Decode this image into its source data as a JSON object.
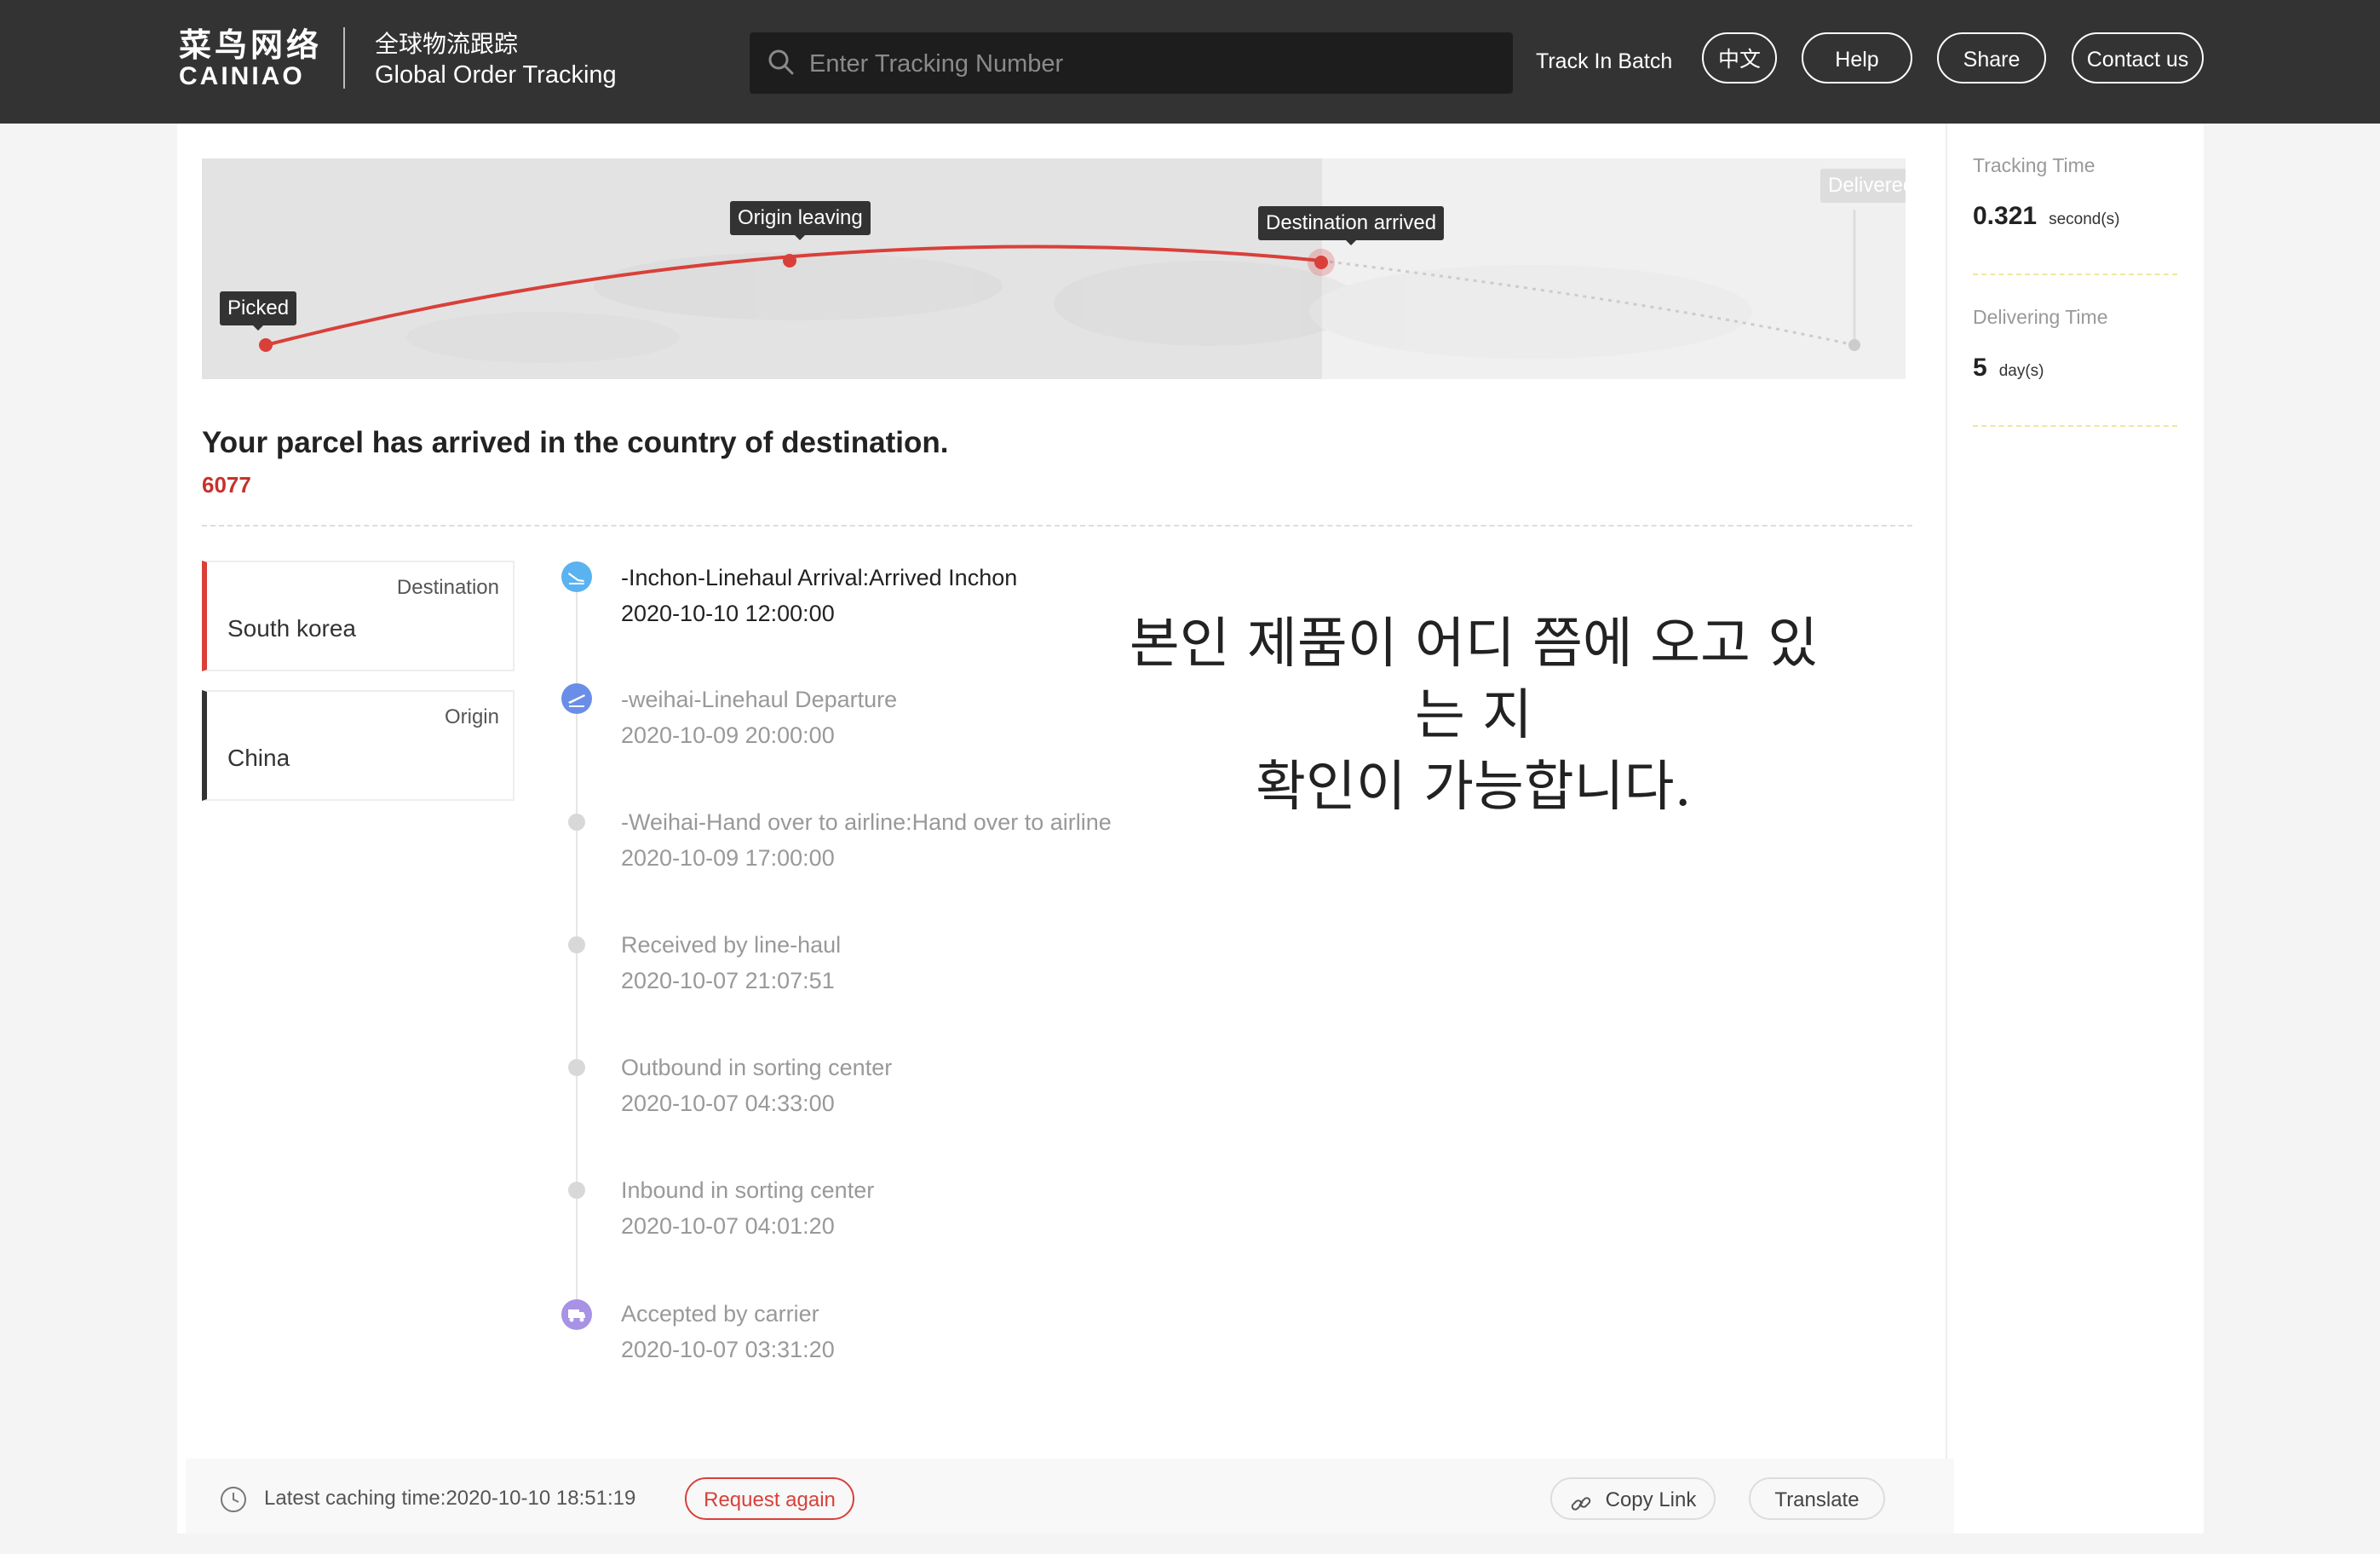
{
  "header": {
    "logo_cn": "菜鸟网络",
    "logo_en": "CAINIAO",
    "title_cn": "全球物流跟踪",
    "title_en": "Global Order Tracking",
    "search_placeholder": "Enter Tracking Number",
    "track_in_batch": "Track In Batch",
    "nav": [
      "中文",
      "Help",
      "Share",
      "Contact us"
    ]
  },
  "route_map": {
    "stages": [
      "Picked",
      "Origin leaving",
      "Destination arrived",
      "Delivered"
    ],
    "current_stage": "Destination arrived",
    "colors": {
      "route": "#d9403a",
      "pending": "#cccccc"
    }
  },
  "summary": {
    "headline": "Your parcel has arrived in the country of destination.",
    "code": "6077"
  },
  "locations": {
    "destination_label": "Destination",
    "destination_value": "South korea",
    "origin_label": "Origin",
    "origin_value": "China"
  },
  "events": [
    {
      "title": "-Inchon-Linehaul Arrival:Arrived Inchon",
      "time": "2020-10-10 12:00:00",
      "icon": "plane-landing-icon"
    },
    {
      "title": "-weihai-Linehaul Departure",
      "time": "2020-10-09 20:00:00",
      "icon": "plane-takeoff-icon"
    },
    {
      "title": "-Weihai-Hand over to airline:Hand over to airline",
      "time": "2020-10-09 17:00:00",
      "icon": "dot-icon"
    },
    {
      "title": "Received by line-haul",
      "time": "2020-10-07 21:07:51",
      "icon": "dot-icon"
    },
    {
      "title": "Outbound in sorting center",
      "time": "2020-10-07 04:33:00",
      "icon": "dot-icon"
    },
    {
      "title": "Inbound in sorting center",
      "time": "2020-10-07 04:01:20",
      "icon": "dot-icon"
    },
    {
      "title": "Accepted by carrier",
      "time": "2020-10-07 03:31:20",
      "icon": "truck-icon"
    }
  ],
  "annotation": [
    "본인 제품이 어디 쯤에 오고 있는 지",
    "확인이 가능합니다."
  ],
  "sidebar": {
    "tracking_time_label": "Tracking Time",
    "tracking_time_value": "0.321",
    "tracking_time_unit": "second(s)",
    "delivering_time_label": "Delivering Time",
    "delivering_time_value": "5",
    "delivering_time_unit": "day(s)"
  },
  "footer": {
    "cache_text": "Latest caching time:2020-10-10 18:51:19",
    "request_again": "Request again",
    "copy_link": "Copy Link",
    "translate": "Translate"
  }
}
